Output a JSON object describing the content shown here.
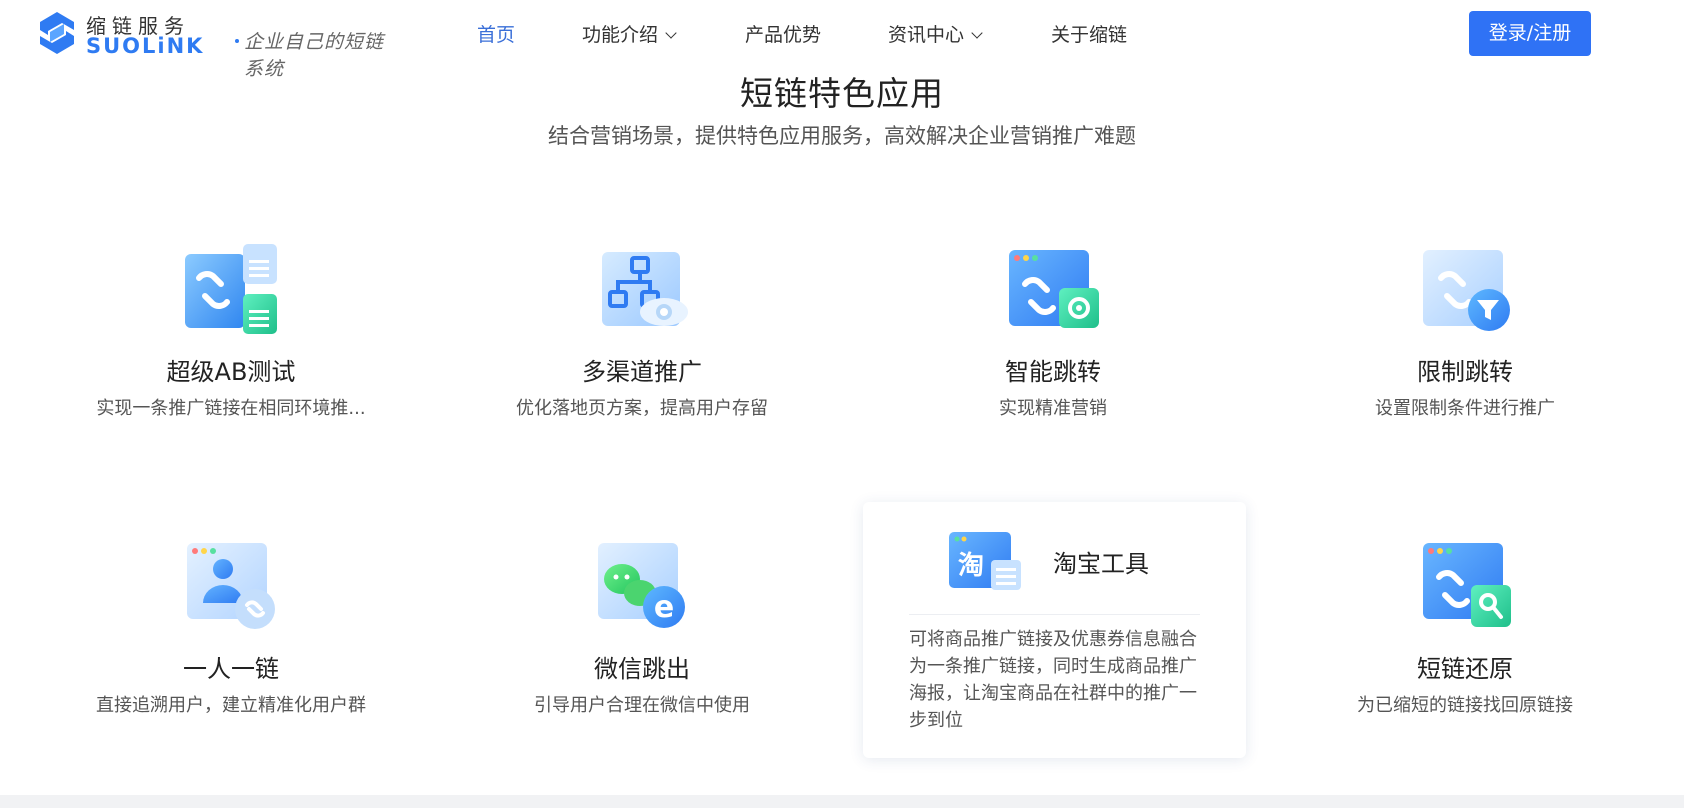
{
  "logo": {
    "cn": "缩链服务",
    "en": "SUOLiNK",
    "slogan": "企业自己的短链系统"
  },
  "nav": {
    "items": [
      {
        "label": "首页",
        "active": true,
        "dropdown": false
      },
      {
        "label": "功能介绍",
        "active": false,
        "dropdown": true
      },
      {
        "label": "产品优势",
        "active": false,
        "dropdown": false
      },
      {
        "label": "资讯中心",
        "active": false,
        "dropdown": true
      },
      {
        "label": "关于缩链",
        "active": false,
        "dropdown": false
      }
    ],
    "login_label": "登录/注册"
  },
  "section": {
    "title": "短链特色应用",
    "subtitle": "结合营销场景，提供特色应用服务，高效解决企业营销推广难题"
  },
  "features": [
    {
      "title": "超级AB测试",
      "desc": "实现一条推广链接在相同环境推...",
      "icon": "ab-test-icon"
    },
    {
      "title": "多渠道推广",
      "desc": "优化落地页方案，提高用户存留",
      "icon": "multichannel-icon"
    },
    {
      "title": "智能跳转",
      "desc": "实现精准营销",
      "icon": "smart-redirect-icon"
    },
    {
      "title": "限制跳转",
      "desc": "设置限制条件进行推广",
      "icon": "restrict-redirect-icon"
    },
    {
      "title": "一人一链",
      "desc": "直接追溯用户，建立精准化用户群",
      "icon": "one-person-link-icon"
    },
    {
      "title": "微信跳出",
      "desc": "引导用户合理在微信中使用",
      "icon": "wechat-jump-icon"
    },
    {
      "title": "淘宝工具",
      "desc": "可将商品推广链接及优惠券信息融合为一条推广链接，同时生成商品推广海报，让淘宝商品在社群中的推广一步到位",
      "icon": "taobao-tool-icon"
    },
    {
      "title": "短链还原",
      "desc": "为已缩短的链接找回原链接",
      "icon": "link-restore-icon"
    }
  ],
  "colors": {
    "accent": "#2f72f5",
    "nav_active": "#3a6fd8",
    "icon_blue": "#3d8ff5",
    "icon_green": "#2fd0a0"
  }
}
